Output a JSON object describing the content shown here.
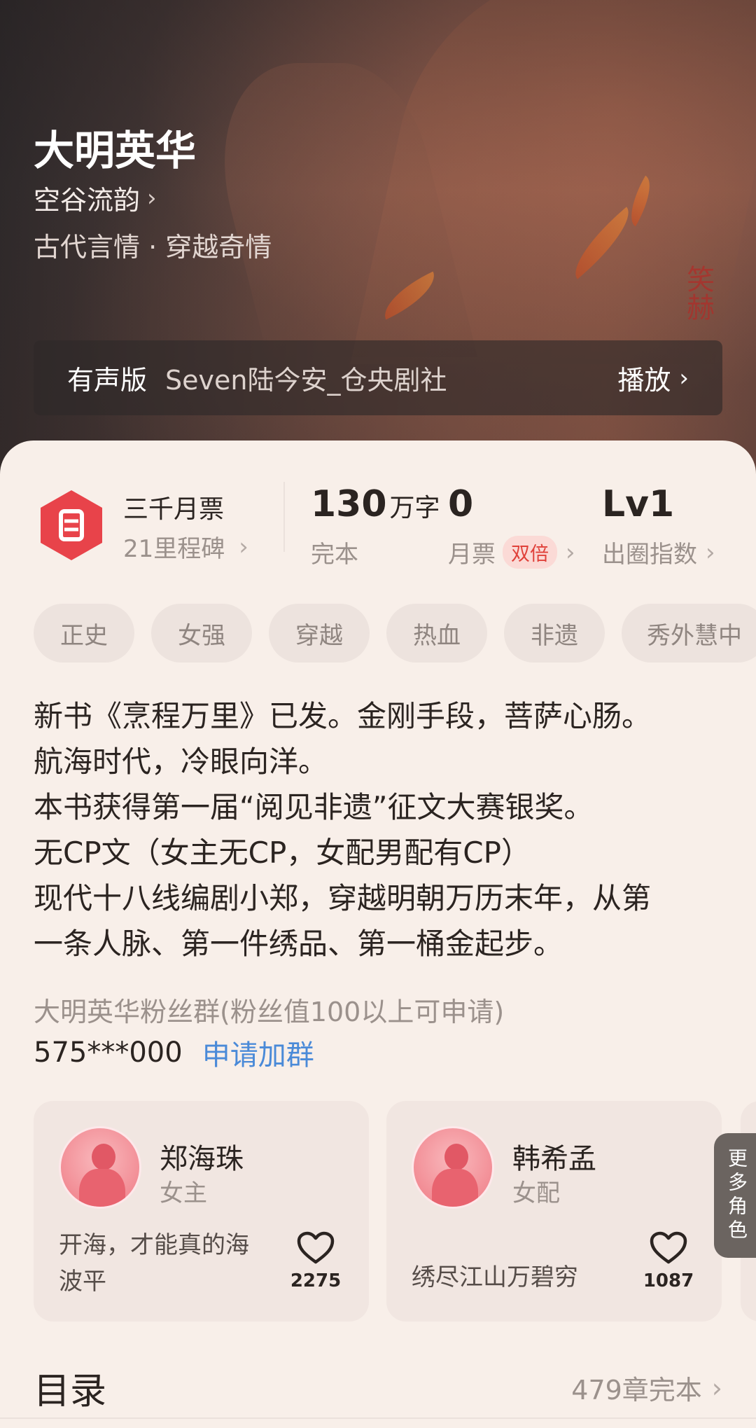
{
  "book": {
    "title": "大明英华",
    "author": "空谷流韵",
    "genre": "古代言情 · 穿越奇情"
  },
  "audio": {
    "label": "有声版",
    "reader": "Seven陆今安_仓央剧社",
    "play": "播放"
  },
  "badge": {
    "title": "三千月票",
    "subtitle": "21里程碑"
  },
  "stats": {
    "words_value": "130",
    "words_unit": "万字",
    "words_label": "完本",
    "tickets_value": "0",
    "tickets_label": "月票",
    "tickets_badge": "双倍",
    "level_value": "Lv1",
    "level_label": "出圈指数"
  },
  "tags": [
    "正史",
    "女强",
    "穿越",
    "热血",
    "非遗",
    "秀外慧中"
  ],
  "intro": [
    "新书《烹程万里》已发。金刚手段，菩萨心肠。",
    "航海时代，冷眼向洋。",
    "本书获得第一届“阅见非遗”征文大赛银奖。",
    "无CP文（女主无CP，女配男配有CP）",
    "现代十八线编剧小郑，穿越明朝万历末年，从第",
    "一条人脉、第一件绣品、第一桶金起步。"
  ],
  "fan_group": {
    "title": "大明英华粉丝群(粉丝值100以上可申请)",
    "number": "575***000",
    "join": "申请加群"
  },
  "roles": [
    {
      "name": "郑海珠",
      "type": "女主",
      "quote": "开海，才能真的海波平",
      "likes": "2275"
    },
    {
      "name": "韩希孟",
      "type": "女配",
      "quote": "绣尽江山万碧穷",
      "likes": "1087"
    }
  ],
  "more_roles": "更多角色",
  "toc": {
    "title": "目录",
    "status": "479章完本"
  },
  "colors": {
    "accent_red": "#e8434a",
    "link_blue": "#4a8ad8",
    "badge_red": "#e0413a"
  }
}
